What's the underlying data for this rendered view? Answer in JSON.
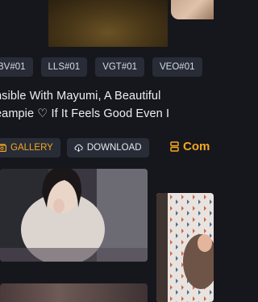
{
  "tags": [
    "BV#01",
    "LLS#01",
    "VGT#01",
    "VEO#01"
  ],
  "title_lines": [
    "nsible With Mayumi, A Beautiful",
    "eampie ♡ If It Feels Good Even I"
  ],
  "actions": {
    "gallery_label": "GALLERY",
    "download_label": "DOWNLOAD",
    "comments_label": "Com"
  },
  "colors": {
    "accent": "#f5a623",
    "background": "#15171c",
    "tag_background": "#272c36"
  },
  "icons": {
    "gallery": "gallery-icon",
    "download": "cloud-download-icon",
    "comments": "comments-icon"
  }
}
